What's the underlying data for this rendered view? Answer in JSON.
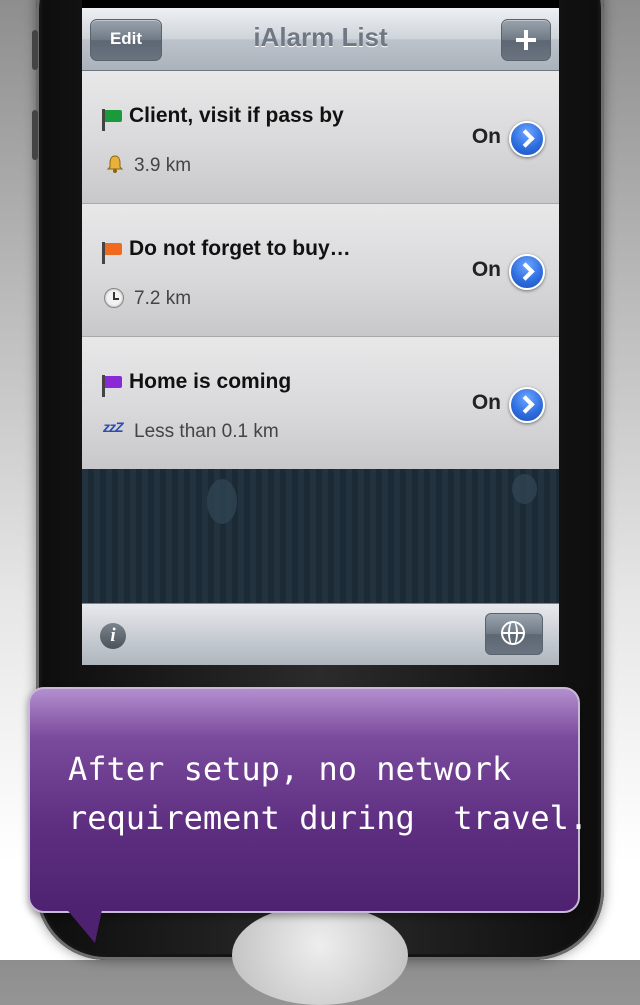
{
  "navbar": {
    "title": "iAlarm List",
    "edit_label": "Edit",
    "add_icon": "plus-icon"
  },
  "alarms": [
    {
      "title": "Client, visit if pass by",
      "flag_color": "#1a9a3a",
      "sub_icon": "bell-icon",
      "distance": "3.9 km",
      "status": "On"
    },
    {
      "title": "Do not forget to buy…",
      "flag_color": "#f06a1e",
      "sub_icon": "clock-icon",
      "distance": "7.2 km",
      "status": "On"
    },
    {
      "title": "Home is coming",
      "flag_color": "#8a2ad6",
      "sub_icon": "zzz-icon",
      "zzz_text": "zzZ",
      "distance": "Less than 0.1 km",
      "status": "On"
    }
  ],
  "toolbar": {
    "info_label": "i",
    "globe_icon": "globe-icon"
  },
  "caption": {
    "text": "After setup, no network\nrequirement during  travel."
  }
}
